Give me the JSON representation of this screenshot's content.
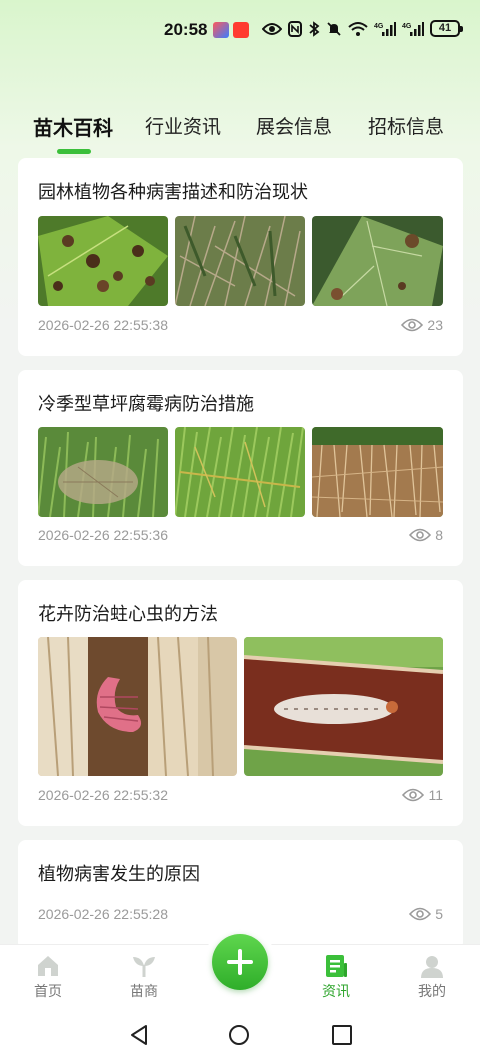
{
  "status_bar": {
    "time": "20:58",
    "battery": "41",
    "icons": [
      "eye-icon",
      "nfc-icon",
      "bluetooth-icon",
      "mute-icon",
      "wifi-icon",
      "signal-4g-icon",
      "signal-4g-icon"
    ]
  },
  "tabs": [
    {
      "label": "苗木百科",
      "active": true
    },
    {
      "label": "行业资讯",
      "active": false
    },
    {
      "label": "展会信息",
      "active": false
    },
    {
      "label": "招标信息",
      "active": false
    }
  ],
  "articles": [
    {
      "title": "园林植物各种病害描述和防治现状",
      "date": "2026-02-26 22:55:38",
      "views": "23",
      "image_count": 3
    },
    {
      "title": "冷季型草坪腐霉病防治措施",
      "date": "2026-02-26 22:55:36",
      "views": "8",
      "image_count": 3
    },
    {
      "title": "花卉防治蛀心虫的方法",
      "date": "2026-02-26 22:55:32",
      "views": "11",
      "image_count": 2
    },
    {
      "title": "植物病害发生的原因",
      "date": "2026-02-26 22:55:28",
      "views": "5",
      "image_count": 0
    }
  ],
  "bottom_nav": [
    {
      "label": "首页",
      "icon": "home-icon",
      "active": false
    },
    {
      "label": "苗商",
      "icon": "sprout-icon",
      "active": false
    },
    {
      "label": "资讯",
      "icon": "news-icon",
      "active": true
    },
    {
      "label": "我的",
      "icon": "user-icon",
      "active": false
    }
  ],
  "colors": {
    "accent": "#3bbf3a",
    "fab": "#2fae2a",
    "text_secondary": "#9a9a9a"
  }
}
